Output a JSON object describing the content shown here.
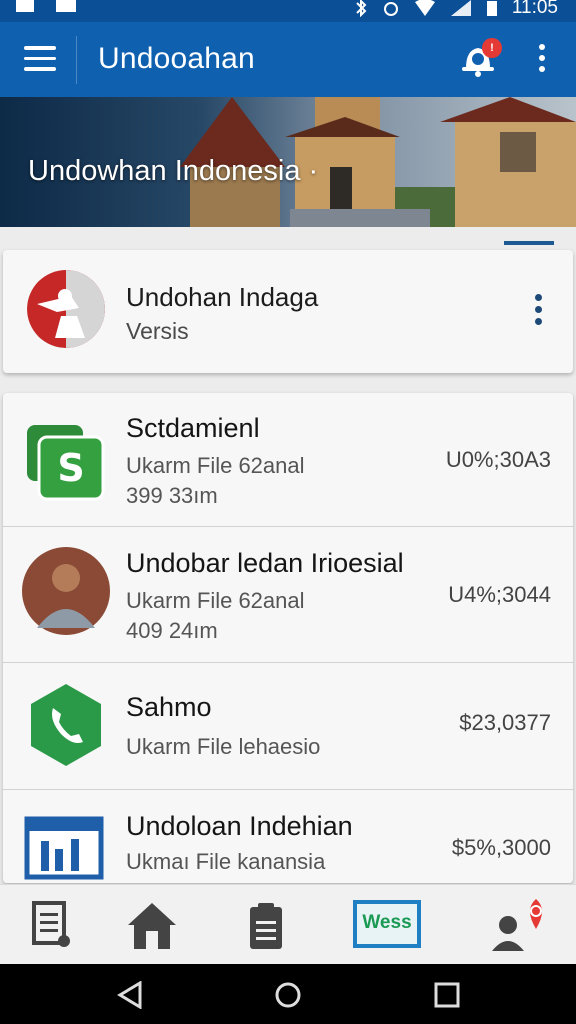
{
  "status_bar": {
    "time": "11:05"
  },
  "app_bar": {
    "title": "Undooahan",
    "notification_badge": "!"
  },
  "banner": {
    "title": "Undowhan Indonesia ·"
  },
  "featured": {
    "title": "Undohan Indaga",
    "subtitle": "Versis"
  },
  "list": [
    {
      "title": "Sctdamienl",
      "line1": "Ukarm File 62anal",
      "line2": "399 33ım",
      "amount": "U0%;30A3",
      "icon": "money-app-icon"
    },
    {
      "title": "Undobar ledan Iriοesial",
      "line1": "Ukarm File 62anal",
      "line2": "409 24ım",
      "amount": "U4%;3044",
      "icon": "person-avatar"
    },
    {
      "title": "Sahmo",
      "line1": "Ukarm File lehaesio",
      "line2": "",
      "amount": "$23,0377",
      "icon": "phone-app-icon"
    },
    {
      "title": "Undoloan Indehian",
      "line1": "Ukmaı File kanansia",
      "line2": "",
      "amount": "$5%,3000",
      "icon": "chart-app-icon"
    }
  ],
  "bottom_nav": {
    "items": [
      "document-icon",
      "home-icon",
      "clipboard-icon",
      "wess-icon",
      "profile-alert-icon"
    ],
    "wess_label": "Wess"
  },
  "colors": {
    "primary": "#1060b0",
    "status": "#0b4f96",
    "accent_green": "#1a9a52",
    "alert_red": "#e53935"
  }
}
